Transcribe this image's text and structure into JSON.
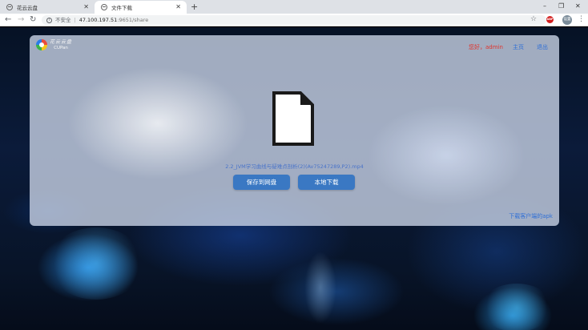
{
  "browser": {
    "tabs": [
      {
        "label": "花云云盘",
        "active": false
      },
      {
        "label": "文件下载",
        "active": true
      }
    ],
    "new_tab": "+",
    "window_controls": {
      "minimize": "–",
      "maximize": "❐",
      "close": "✕"
    },
    "nav": {
      "back": "←",
      "forward": "→",
      "reload": "↻"
    },
    "address": {
      "security_label": "不安全",
      "separator": "|",
      "host": "47.100.197.51",
      "path": ":9651/share"
    },
    "extensions": {
      "abp": "ABP",
      "profile": "设置"
    },
    "icons": {
      "star": "star-icon",
      "menu": "menu-icon"
    }
  },
  "page": {
    "logo": {
      "cn": "花云云盘",
      "en": "CUPan"
    },
    "header": {
      "greeting": "您好，admin",
      "home": "主页",
      "logout": "退出"
    },
    "file": {
      "name": "2.2_JVM学习曲线与疑难点剖析(2)(Av75247289,P2).mp4"
    },
    "buttons": {
      "save": "保存到网盘",
      "download": "本地下载"
    },
    "apk_link": "下载客户端的apk"
  },
  "colors": {
    "accent": "#3a78c3",
    "greeting": "#e0342d",
    "link": "#2f6fd6"
  }
}
